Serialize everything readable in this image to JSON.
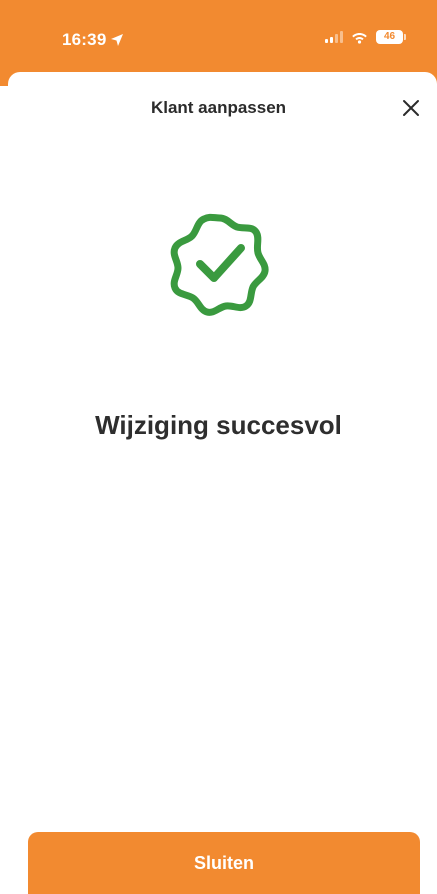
{
  "status_bar": {
    "time": "16:39",
    "battery": "46",
    "location_icon": "location-arrow-icon",
    "wifi_icon": "wifi-icon"
  },
  "sheet": {
    "title": "Klant aanpassen",
    "close_icon": "close-icon"
  },
  "result": {
    "icon": "success-badge-check-icon",
    "message": "Wijziging succesvol"
  },
  "actions": {
    "close_label": "Sluiten"
  },
  "colors": {
    "accent": "#F28A30",
    "success": "#3A9A3F",
    "text": "#2E2E2E",
    "background": "#FFFFFF"
  }
}
